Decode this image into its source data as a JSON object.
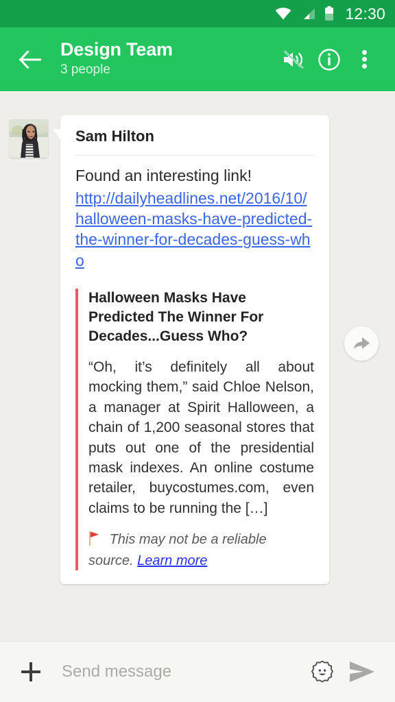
{
  "statusbar": {
    "time": "12:30",
    "icons": [
      "wifi-icon",
      "cellular-signal-icon",
      "battery-icon"
    ]
  },
  "appbar": {
    "back_label": "back-arrow",
    "title": "Design Team",
    "subtitle": "3 people",
    "actions": [
      {
        "name": "mute-icon",
        "label": "Mute"
      },
      {
        "name": "info-icon",
        "label": "Group info"
      },
      {
        "name": "overflow-menu-icon",
        "label": "More options"
      }
    ],
    "colors": {
      "appbar": "#22C55E",
      "statusbar": "#14A04B"
    }
  },
  "message": {
    "sender": "Sam Hilton",
    "avatar_alt": "Sam Hilton profile photo",
    "text": "Found an interesting link!",
    "link": "http://dailyheadlines.net/2016/10/halloween-masks-have-predicted-the-winner-for-decades-guess-who",
    "preview": {
      "title": "Halloween Masks Have Predicted The Winner For Decades...Guess Who?",
      "body": "“Oh, it’s definitely all about mocking them,” said Chloe Nelson, a manager at Spirit Halloween, a chain of 1,200 seasonal stores that puts out one of the presidential mask indexes. An online costume retailer, buycostumes.com, even claims to be running the […]",
      "accent_color": "#F05A60",
      "warning_text": "This may not be a reliable source.",
      "warning_link": "Learn more",
      "warning_icon": "red-flag-icon"
    }
  },
  "forward_button": {
    "name": "forward-icon",
    "label": "Forward"
  },
  "inputbar": {
    "plus_label": "Add attachment",
    "placeholder": "Send message",
    "value": "",
    "sticker_label": "Stickers",
    "send_label": "Send"
  }
}
